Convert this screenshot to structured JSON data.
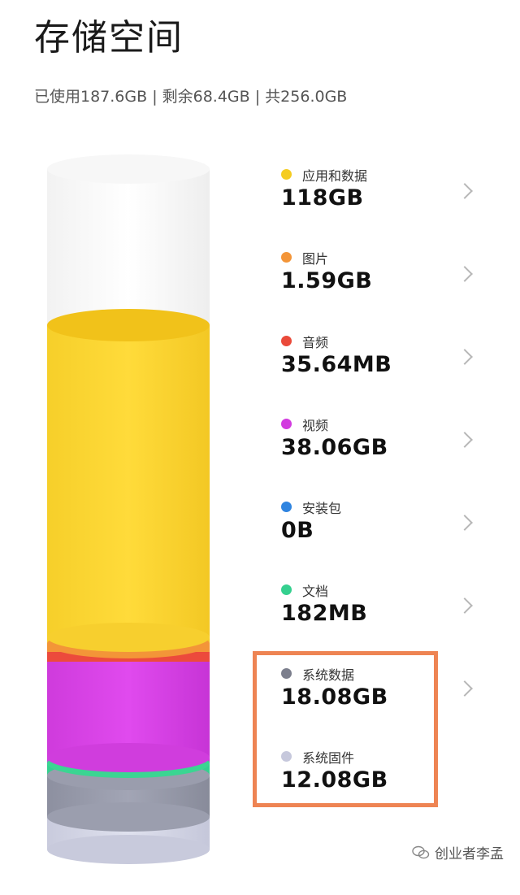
{
  "title": "存储空间",
  "summary": "已使用187.6GB | 剩余68.4GB | 共256.0GB",
  "categories": [
    {
      "label": "应用和数据",
      "value": "118GB",
      "color": "#f5cc20"
    },
    {
      "label": "图片",
      "value": "1.59GB",
      "color": "#f39538"
    },
    {
      "label": "音频",
      "value": "35.64MB",
      "color": "#ea4a3a"
    },
    {
      "label": "视频",
      "value": "38.06GB",
      "color": "#d23bdf"
    },
    {
      "label": "安装包",
      "value": "0B",
      "color": "#2f84e0"
    },
    {
      "label": "文档",
      "value": "182MB",
      "color": "#35d08f"
    },
    {
      "label": "系统数据",
      "value": "18.08GB",
      "color": "#7c7f8d"
    },
    {
      "label": "系统固件",
      "value": "12.08GB",
      "color": "#c6c8dc"
    }
  ],
  "highlight_color": "#ee8453",
  "watermark": "创业者李孟"
}
